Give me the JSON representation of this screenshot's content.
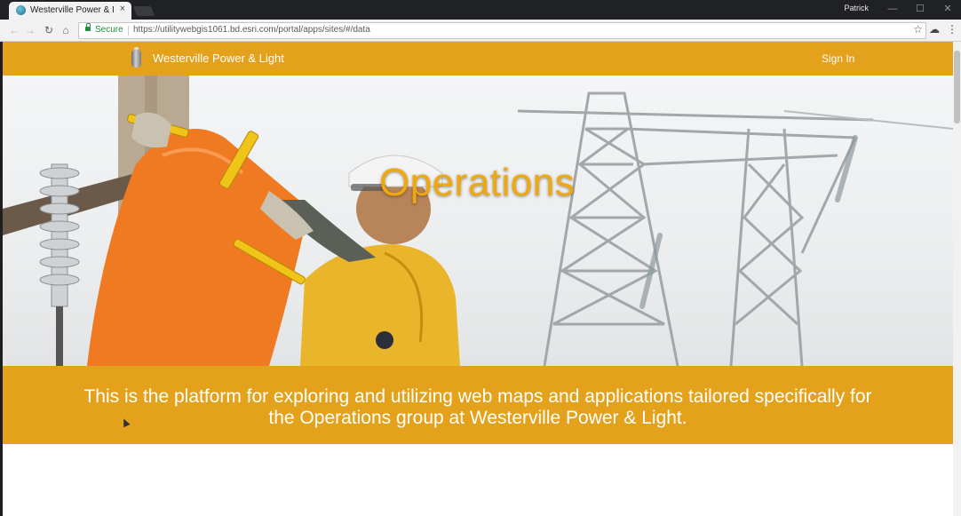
{
  "browser": {
    "tab_title": "Westerville Power & Light",
    "tab_close": "×",
    "user_name": "Patrick",
    "secure_label": "Secure",
    "url": "https://utilitywebgis1061.bd.esri.com/portal/apps/sites/#/data",
    "window_controls": [
      "—",
      "☐",
      "✕"
    ]
  },
  "site": {
    "name": "Westerville Power & Light",
    "sign_in": "Sign In",
    "hero_title": "Operations",
    "banner_text": "This is the platform for exploring and utilizing web maps and applications tailored specifically for the Operations group at Westerville Power & Light."
  },
  "colors": {
    "brand": "#e4a11b",
    "hero_title": "#f0a810"
  }
}
